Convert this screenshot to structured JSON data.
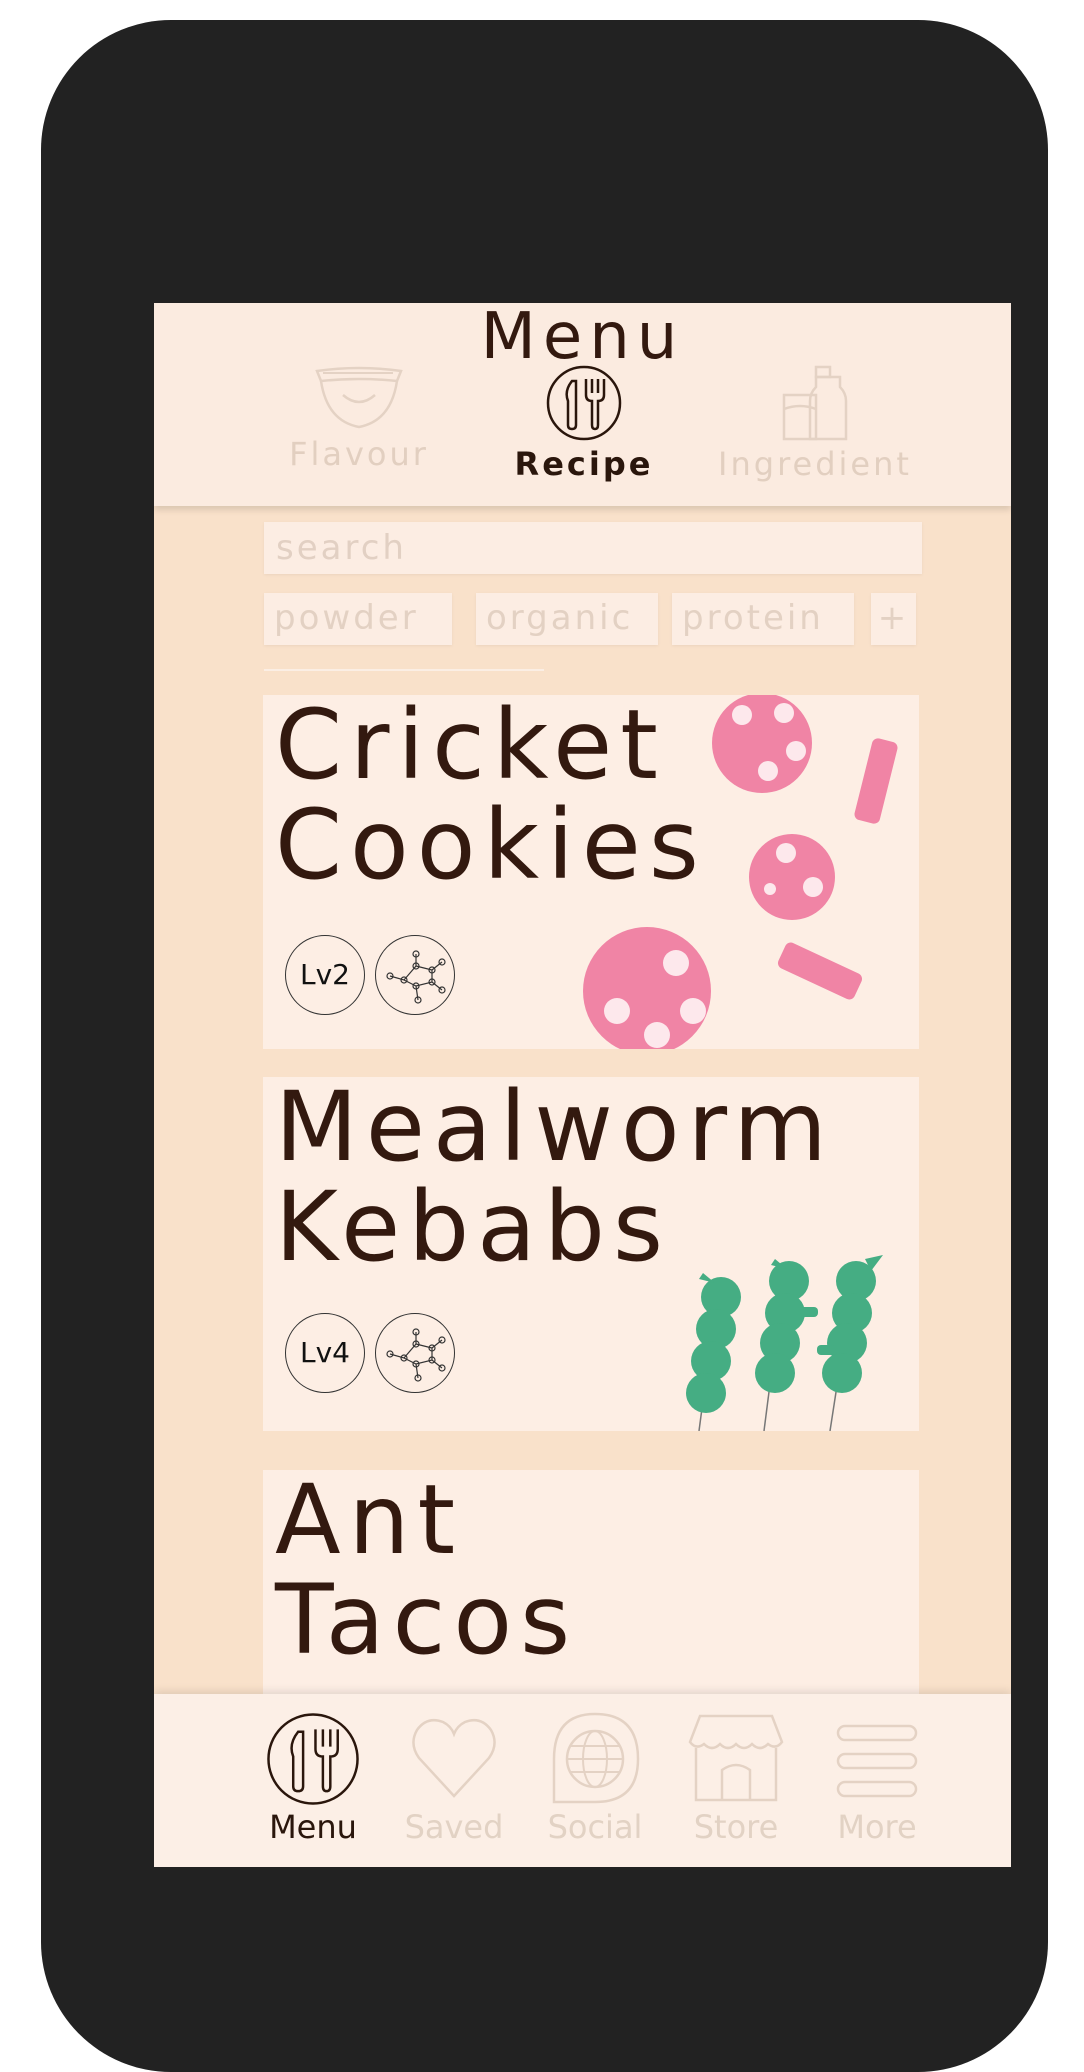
{
  "header": {
    "title": "Menu",
    "tabs": [
      {
        "label": "Flavour",
        "icon": "lips-icon",
        "active": false
      },
      {
        "label": "Recipe",
        "icon": "utensils-icon",
        "active": true
      },
      {
        "label": "Ingredient",
        "icon": "bottle-icon",
        "active": false
      }
    ]
  },
  "search": {
    "placeholder": "search"
  },
  "chips": [
    "powder",
    "organic",
    "protein",
    "+"
  ],
  "recipes": [
    {
      "title": "Cricket\nCookies",
      "level": "Lv2",
      "illustration": "cookies"
    },
    {
      "title": "Mealworm\nKebabs",
      "level": "Lv4",
      "illustration": "kebabs"
    },
    {
      "title": "Ant\nTacos"
    }
  ],
  "bottom_nav": [
    {
      "label": "Menu",
      "icon": "utensils-icon",
      "active": true
    },
    {
      "label": "Saved",
      "icon": "heart-icon",
      "active": false
    },
    {
      "label": "Social",
      "icon": "globe-icon",
      "active": false
    },
    {
      "label": "Store",
      "icon": "store-icon",
      "active": false
    },
    {
      "label": "More",
      "icon": "menu-lines-icon",
      "active": false
    }
  ],
  "colors": {
    "background": "#f9e1ca",
    "card": "#fdeee4",
    "text_dark": "#33190f",
    "inactive": "#e2d0c3",
    "cookie_pink": "#f084a5",
    "kebab_green": "#45ad83"
  }
}
